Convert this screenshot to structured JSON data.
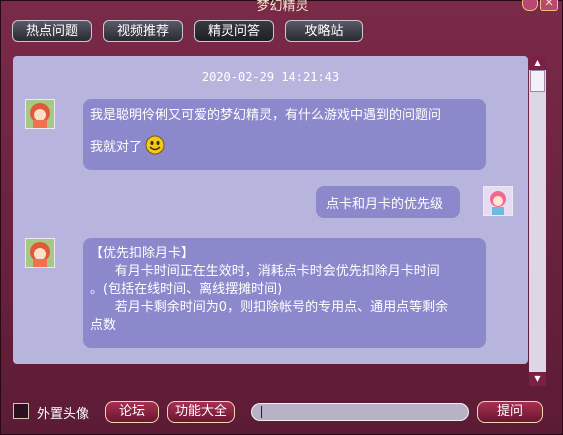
{
  "window": {
    "title": "梦幻精灵",
    "close_glyph": "✕"
  },
  "tabs": [
    {
      "label": "热点问题"
    },
    {
      "label": "视频推荐"
    },
    {
      "label": "精灵问答",
      "active": true
    },
    {
      "label": "攻略站"
    }
  ],
  "chat": {
    "timestamp": "2020-02-29 14:21:43",
    "messages": [
      {
        "from": "bot",
        "avatar_icon": "sprite-avatar-icon",
        "line1": "我是聪明伶俐又可爱的梦幻精灵，有什么游戏中遇到的问题问",
        "line2": "我就对了",
        "emoji": "smiley-icon"
      },
      {
        "from": "user",
        "avatar_icon": "user-avatar-icon",
        "text": "点卡和月卡的优先级"
      },
      {
        "from": "bot",
        "avatar_icon": "sprite-avatar-icon",
        "lines": [
          "【优先扣除月卡】",
          "      有月卡时间正在生效时，消耗点卡时会优先扣除月卡时间",
          "。(包括在线时间、离线摆摊时间)",
          "      若月卡剩余时间为0，则扣除帐号的专用点、通用点等剩余",
          "点数"
        ]
      }
    ]
  },
  "bottom": {
    "avatar_checkbox_label": "外置头像",
    "avatar_checkbox_checked": false,
    "forum_button": "论坛",
    "features_button": "功能大全",
    "question_input_value": "",
    "ask_button": "提问"
  },
  "colors": {
    "frame": "#6e2340",
    "chat_bg": "#b7b5dd",
    "bubble": "#8c88cc",
    "button": "#8a2040"
  }
}
